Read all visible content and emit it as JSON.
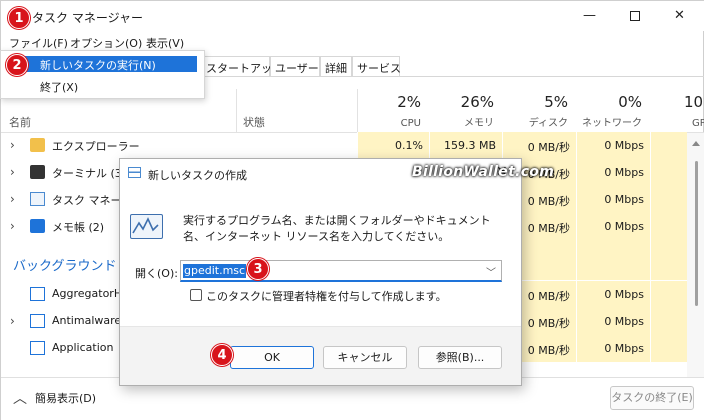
{
  "window": {
    "title": "タスク マネージャー"
  },
  "menu": {
    "file": "ファイル(F)",
    "options": "オプション(O)",
    "view": "表示(V)"
  },
  "file_menu": {
    "run_new_task": "新しいタスクの実行(N)",
    "exit": "終了(X)"
  },
  "tabs": [
    "スタートアップ",
    "ユーザー",
    "詳細",
    "サービス"
  ],
  "columns": {
    "name": "名前",
    "status": "状態",
    "cpu": {
      "pct": "2%",
      "label": "CPU"
    },
    "memory": {
      "pct": "26%",
      "label": "メモリ"
    },
    "disk": {
      "pct": "5%",
      "label": "ディスク"
    },
    "network": {
      "pct": "0%",
      "label": "ネットワーク"
    },
    "gpu": {
      "pct": "10%",
      "label": "GP"
    }
  },
  "rows": [
    {
      "name": "エクスプローラー",
      "cpu": "0.1%",
      "mem": "159.3 MB",
      "disk": "0 MB/秒",
      "net": "0 Mbps"
    },
    {
      "name": "ターミナル (3)",
      "cpu": "",
      "mem": "",
      "disk": "0 MB/秒",
      "net": "0 Mbps"
    },
    {
      "name": "タスク マネージャー",
      "cpu": "",
      "mem": "",
      "disk": "0 MB/秒",
      "net": "0 Mbps"
    },
    {
      "name": "メモ帳 (2)",
      "cpu": "",
      "mem": "",
      "disk": "0 MB/秒",
      "net": "0 Mbps"
    }
  ],
  "background_section": "バックグラウンド プ",
  "bg_rows": [
    {
      "name": "AggregatorHost",
      "disk": "0 MB/秒",
      "net": "0 Mbps"
    },
    {
      "name": "Antimalware",
      "disk": "0 MB/秒",
      "net": "0 Mbps"
    },
    {
      "name": "Application",
      "disk": "0 MB/秒",
      "net": "0 Mbps"
    }
  ],
  "footer": {
    "fewer_details": "簡易表示(D)",
    "end_task": "タスクの終了(E)"
  },
  "dialog": {
    "title": "新しいタスクの作成",
    "description": "実行するプログラム名、または開くフォルダーやドキュメント名、インターネット リソース名を入力してください。",
    "open_label": "開く(O):",
    "input_value": "gpedit.msc",
    "admin_checkbox": "このタスクに管理者特権を付与して作成します。",
    "ok": "OK",
    "cancel": "キャンセル",
    "browse": "参照(B)..."
  },
  "badges": [
    "1",
    "2",
    "3",
    "4"
  ],
  "watermark": "BillionWallet.com",
  "colors": {
    "accent": "#1e73d9",
    "badge": "#d8141b",
    "heat": "#fff4c4",
    "section": "#1b6ac9"
  }
}
